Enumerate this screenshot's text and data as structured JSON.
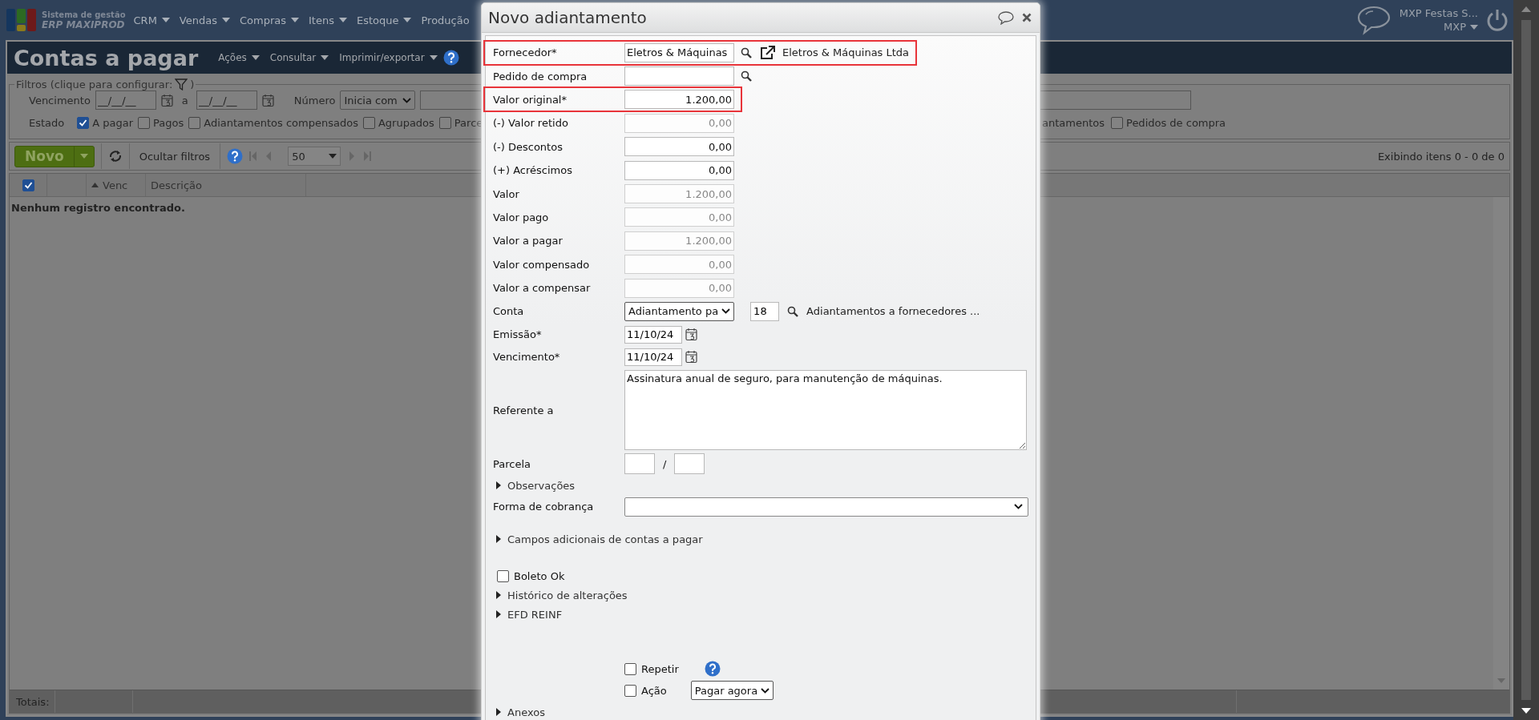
{
  "topbar": {
    "logo_line1": "Sistema de gestão",
    "logo_line2": "ERP MAXIPROD",
    "menus": [
      {
        "label": "CRM",
        "caret": true
      },
      {
        "label": "Vendas",
        "caret": true
      },
      {
        "label": "Compras",
        "caret": true
      },
      {
        "label": "Itens",
        "caret": true
      },
      {
        "label": "Estoque",
        "caret": true
      },
      {
        "label": "Produção",
        "caret": false
      }
    ],
    "company": "MXP Festas S...",
    "user": "MXP"
  },
  "page": {
    "title": "Contas a pagar",
    "menus": [
      "Ações",
      "Consultar",
      "Imprimir/exportar"
    ]
  },
  "filters": {
    "legend": "Filtros (clique para configurar:",
    "legend_end": ")",
    "date_label": "Vencimento",
    "date_from": "__/__/__",
    "date_sep": "a",
    "date_to": "__/__/__",
    "number_label": "Número",
    "number_mode": "Inicia com",
    "state_label": "Estado",
    "states": [
      {
        "label": "A pagar",
        "checked": true
      },
      {
        "label": "Pagos",
        "checked": false
      },
      {
        "label": "Adiantamentos compensados",
        "checked": false
      },
      {
        "label": "Agrupados",
        "checked": false
      },
      {
        "label": "Parce",
        "checked": false
      }
    ],
    "states_right_fragment": "antamentos",
    "states_right": [
      {
        "label": "Pedidos de compra",
        "checked": false
      }
    ]
  },
  "toolbar": {
    "new_button": "Novo",
    "hide_filters": "Ocultar filtros",
    "page_size": "50",
    "summary": "Exibindo itens 0 - 0 de 0"
  },
  "table": {
    "select_all_checked": true,
    "columns": [
      {
        "label": "Venc",
        "sorted": true
      },
      {
        "label": "Descrição",
        "sorted": false
      }
    ],
    "empty_message": "Nenhum registro encontrado.",
    "totals_label": "Totais:"
  },
  "dialog": {
    "title": "Novo adiantamento",
    "rows": [
      {
        "kind": "field",
        "label": "Fornecedor*",
        "value": "Eletros & Máquinas",
        "lookup": true,
        "link": "Eletros & Máquinas Ltda",
        "highlighted": true,
        "disabled": false
      },
      {
        "kind": "field",
        "label": "Pedido de compra",
        "lookup": true,
        "highlighted": false,
        "disabled": false
      },
      {
        "kind": "field",
        "label": "Valor original*",
        "value": "1.200,00",
        "lookup": false,
        "highlighted": true,
        "disabled": false
      },
      {
        "kind": "field",
        "label": "(-) Valor retido",
        "value": "0,00",
        "lookup": false,
        "highlighted": false,
        "disabled": true
      },
      {
        "kind": "field",
        "label": "(-) Descontos",
        "value": "0,00",
        "lookup": false,
        "highlighted": false,
        "disabled": false
      },
      {
        "kind": "field",
        "label": "(+) Acréscimos",
        "value": "0,00",
        "lookup": false,
        "highlighted": false,
        "disabled": false
      },
      {
        "kind": "field",
        "label": "Valor",
        "value": "1.200,00",
        "lookup": false,
        "highlighted": false,
        "disabled": true
      },
      {
        "kind": "field",
        "label": "Valor pago",
        "value": "0,00",
        "lookup": false,
        "highlighted": false,
        "disabled": true
      },
      {
        "kind": "field",
        "label": "Valor a pagar",
        "value": "1.200,00",
        "lookup": false,
        "highlighted": false,
        "disabled": true
      },
      {
        "kind": "field",
        "label": "Valor compensado",
        "value": "0,00",
        "lookup": false,
        "highlighted": false,
        "disabled": true
      },
      {
        "kind": "field",
        "label": "Valor a compensar",
        "value": "0,00",
        "lookup": false,
        "highlighted": false,
        "disabled": true
      },
      {
        "kind": "account",
        "label": "Conta",
        "value": "Adiantamento pa",
        "code": "18",
        "description": "Adiantamentos a fornecedores ..."
      },
      {
        "kind": "date",
        "label": "Emissão*",
        "value": "11/10/24"
      },
      {
        "kind": "date",
        "label": "Vencimento*",
        "value": "11/10/24"
      },
      {
        "kind": "textarea",
        "label": "Referente a",
        "value": "Assinatura anual de seguro, para manutenção de máquinas."
      },
      {
        "kind": "installment",
        "label": "Parcela",
        "separator": "/"
      },
      {
        "kind": "section",
        "label": "Observações",
        "expanded": false
      },
      {
        "kind": "select",
        "label": "Forma de cobrança"
      },
      {
        "kind": "section",
        "label": "Campos adicionais de contas a pagar",
        "expanded": false
      },
      {
        "kind": "checkbox",
        "label": "Boleto Ok",
        "checked": false
      },
      {
        "kind": "section",
        "label": "Histórico de alterações",
        "expanded": false
      },
      {
        "kind": "section",
        "label": "EFD REINF",
        "expanded": false
      },
      {
        "kind": "repeat",
        "label": "Repetir",
        "checked": false
      },
      {
        "kind": "action",
        "label": "Ação",
        "checked": false,
        "option": "Pagar agora"
      },
      {
        "kind": "section",
        "label": "Anexos",
        "expanded": false
      }
    ]
  }
}
